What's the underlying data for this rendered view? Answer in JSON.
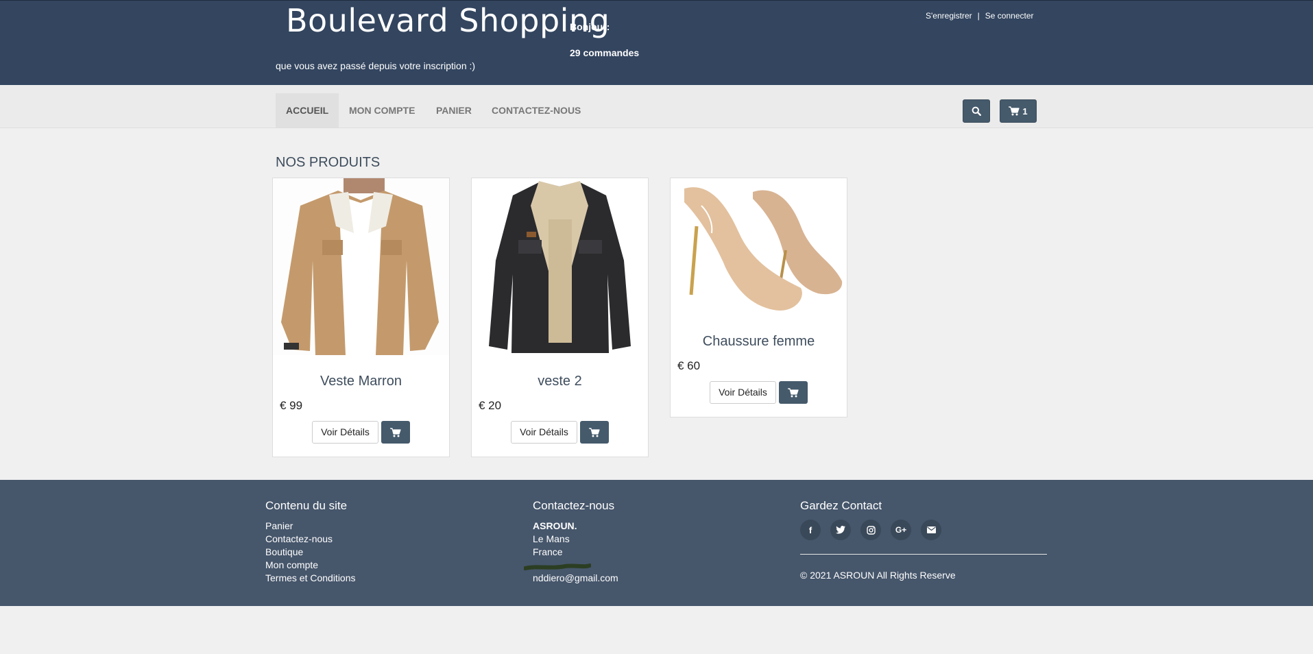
{
  "header": {
    "brand": "Boulevard Shopping",
    "greeting": "Bonjour:",
    "orders": "29 commandes",
    "since": "que vous avez passé depuis votre inscription :)",
    "register": "S'enregistrer",
    "separator": "|",
    "login": "Se connecter"
  },
  "nav": {
    "items": [
      {
        "label": "ACCUEIL",
        "active": true
      },
      {
        "label": "MON COMPTE"
      },
      {
        "label": "PANIER"
      },
      {
        "label": "CONTACTEZ-NOUS"
      }
    ],
    "search_icon": "search-icon",
    "cart_count": "1"
  },
  "products": {
    "title": "NOS PRODUITS",
    "details_label": "Voir Détails",
    "items": [
      {
        "name": "Veste Marron",
        "price": "€ 99"
      },
      {
        "name": "veste 2",
        "price": "€ 20"
      },
      {
        "name": "Chaussure femme",
        "price": "€ 60"
      }
    ]
  },
  "footer": {
    "content_title": "Contenu du site",
    "content_links": [
      "Panier",
      "Contactez-nous",
      "Boutique",
      "Mon compte",
      "Termes et Conditions"
    ],
    "contact_title": "Contactez-nous",
    "contact_name": "ASROUN.",
    "contact_city": "Le Mans",
    "contact_country": "France",
    "contact_email": "nddiero@gmail.com",
    "keep_title": "Gardez Contact",
    "socials": [
      {
        "icon": "facebook-icon",
        "glyph": "f"
      },
      {
        "icon": "twitter-icon",
        "glyph": ""
      },
      {
        "icon": "instagram-icon",
        "glyph": ""
      },
      {
        "icon": "google-plus-icon",
        "glyph": "G+"
      },
      {
        "icon": "envelope-icon",
        "glyph": ""
      }
    ],
    "copyright": "© 2021 ASROUN All Rights Reserve"
  },
  "colors": {
    "header_bg": "#33455f",
    "accent": "#455a6b",
    "footer_bg": "#46566b"
  }
}
